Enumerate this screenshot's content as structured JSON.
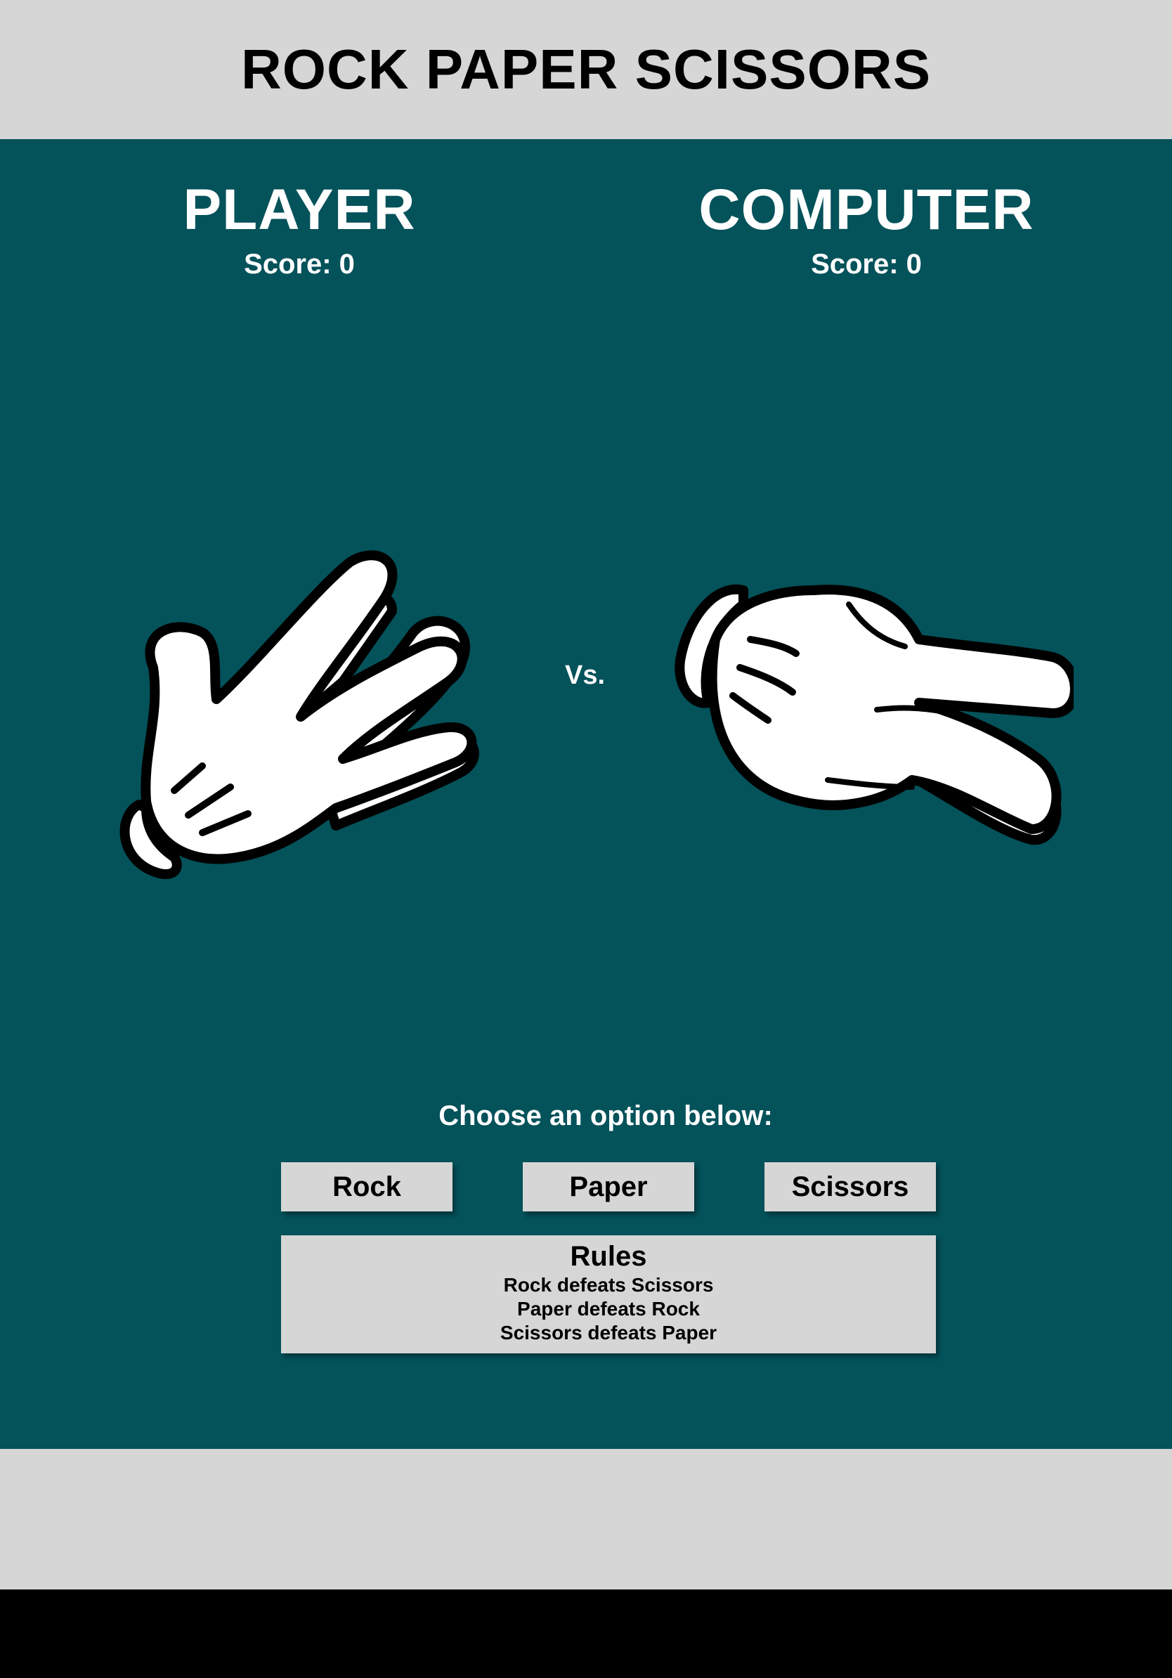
{
  "header": {
    "title": "ROCK PAPER SCISSORS"
  },
  "player": {
    "name": "PLAYER",
    "score_label": "Score: 0",
    "choice_icon": "scissors-hand-icon"
  },
  "computer": {
    "name": "COMPUTER",
    "score_label": "Score: 0",
    "choice_icon": "scissors-hand-icon"
  },
  "versus": "Vs.",
  "prompt": "Choose an option below:",
  "choices": {
    "rock": "Rock",
    "paper": "Paper",
    "scissors": "Scissors"
  },
  "rules": {
    "title": "Rules",
    "items": [
      "Rock defeats Scissors",
      "Paper defeats Rock",
      "Scissors defeats Paper"
    ]
  },
  "colors": {
    "board": "#04525a",
    "panel": "#d6d6d6",
    "text_light": "#ffffff",
    "text_dark": "#000000"
  }
}
